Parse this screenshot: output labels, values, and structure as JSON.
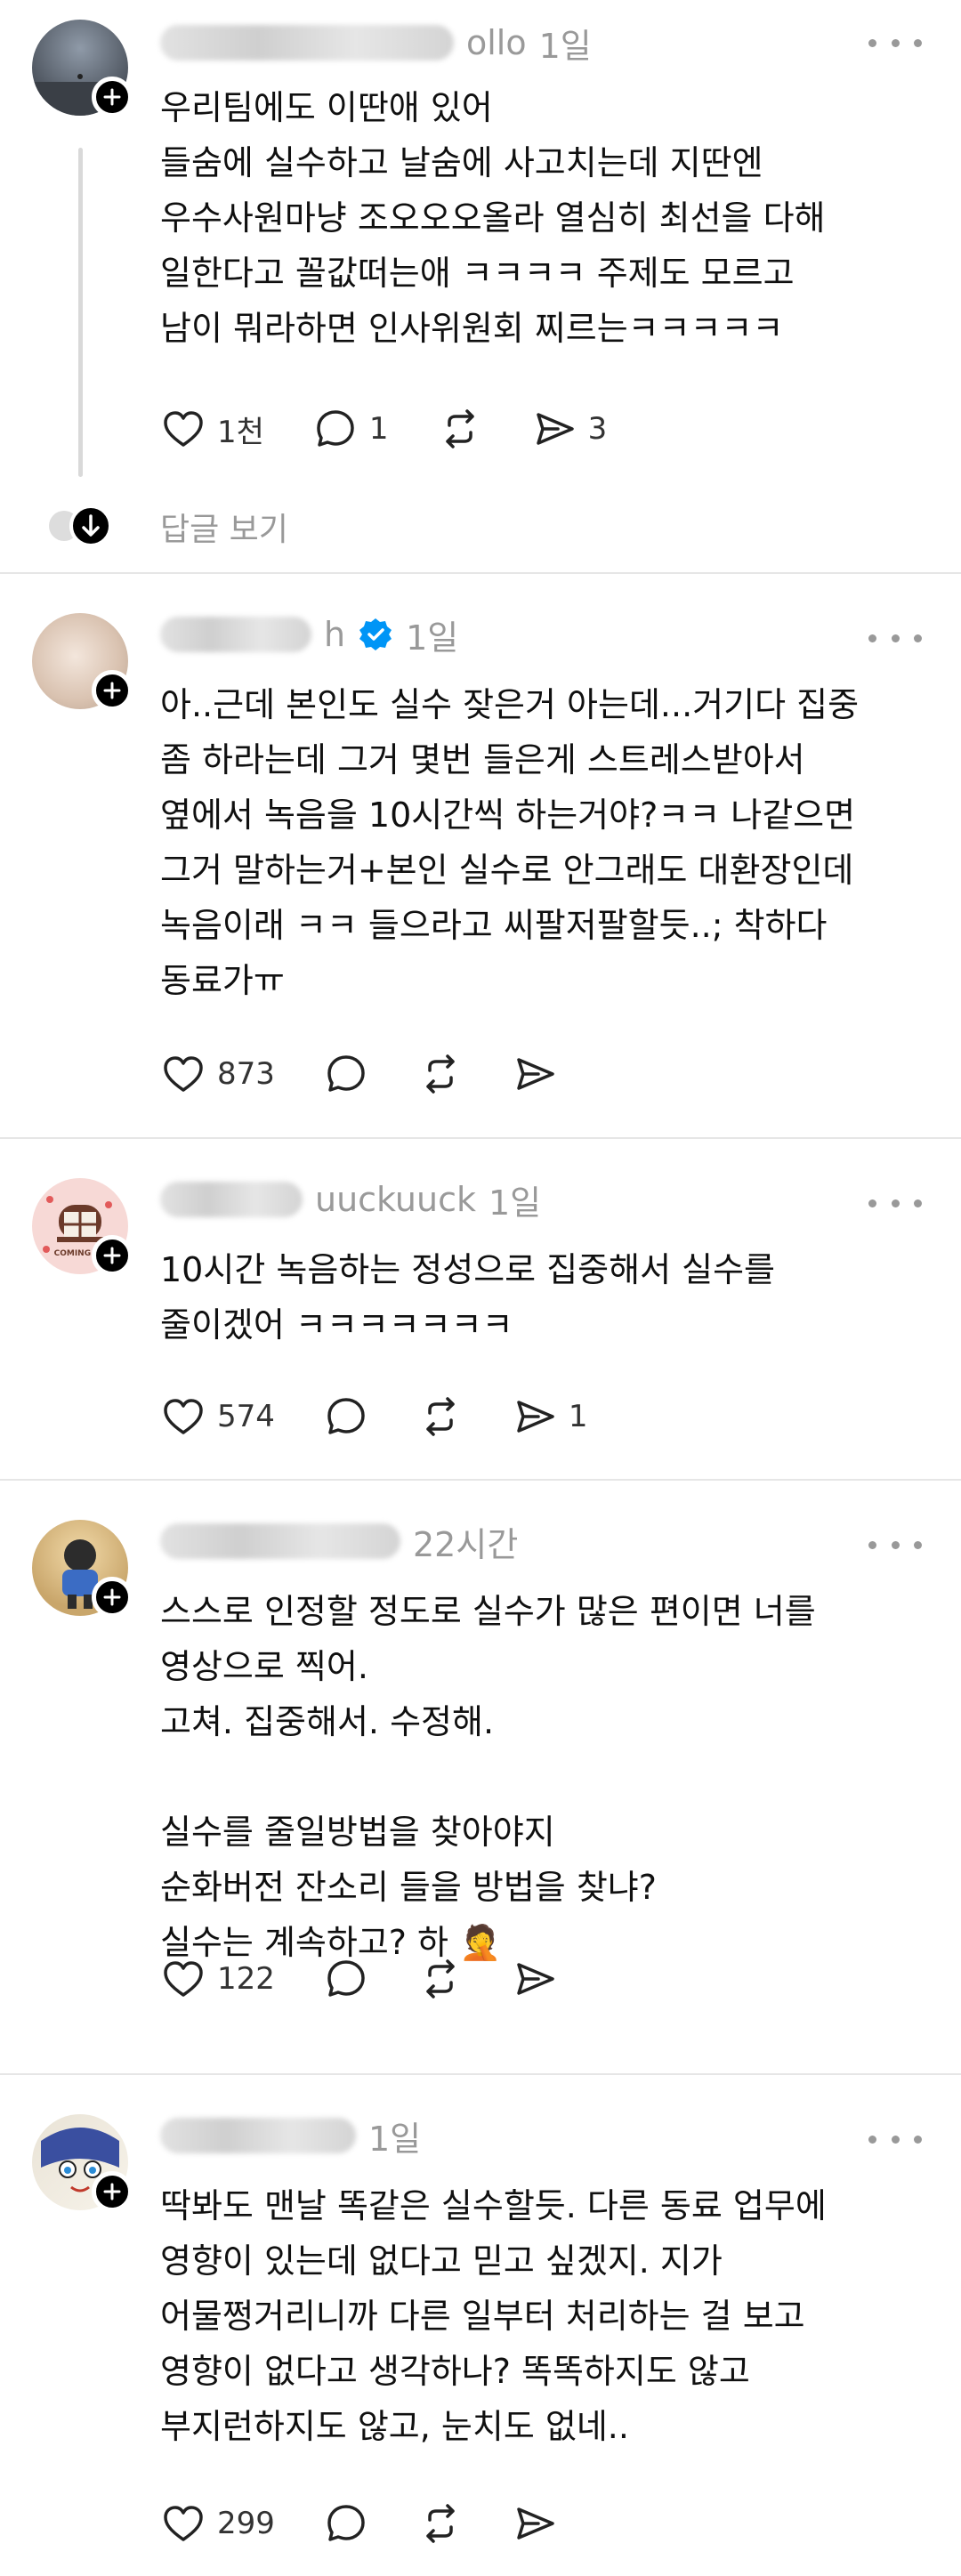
{
  "posts": [
    {
      "age": "1일",
      "username_tail": "ollo",
      "text": "우리팀에도 이딴애 있어\n들숨에 실수하고 날숨에 사고치는데 지딴엔\n우수사원마냥 조오오오올라 열심히 최선을 다해\n일한다고 꼴값떠는애 ㅋㅋㅋㅋ 주제도 모르고\n남이 뭐라하면 인사위원회 찌르는ㅋㅋㅋㅋㅋ",
      "likes": "1천",
      "comments": "1",
      "reposts": "",
      "shares": "3",
      "view_replies": "답글 보기"
    },
    {
      "age": "1일",
      "username_tail": "h",
      "text": "아..근데 본인도 실수 잦은거 아는데...거기다 집중\n좀 하라는데 그거 몇번 들은게 스트레스받아서\n옆에서 녹음을 10시간씩 하는거야?ㅋㅋ 나같으면\n그거 말하는거+본인 실수로 안그래도 대환장인데\n녹음이래 ㅋㅋ 들으라고 씨팔저팔할듯..; 착하다\n동료가ㅠ",
      "likes": "873",
      "comments": "",
      "reposts": "",
      "shares": ""
    },
    {
      "age": "1일",
      "username_tail": "uuckuuck",
      "avatar_label": "COMING SO",
      "text": "10시간 녹음하는 정성으로 집중해서 실수를\n줄이겠어 ㅋㅋㅋㅋㅋㅋㅋ",
      "likes": "574",
      "comments": "",
      "reposts": "",
      "shares": "1"
    },
    {
      "age": "22시간",
      "username_tail": "",
      "text": "스스로 인정할 정도로 실수가 많은 편이면 너를\n영상으로 찍어.\n고쳐. 집중해서. 수정해.\n\n실수를 줄일방법을 찾아야지\n순화버전 잔소리 들을 방법을 찾냐?\n실수는 계속하고? 하 🤦",
      "likes": "122",
      "comments": "",
      "reposts": "",
      "shares": ""
    },
    {
      "age": "1일",
      "username_tail": "",
      "text": "딱봐도 맨날 똑같은 실수할듯. 다른 동료 업무에\n영향이 있는데 없다고 믿고 싶겠지. 지가\n어물쩡거리니까 다른 일부터 처리하는 걸 보고\n영향이 없다고 생각하나? 똑똑하지도 않고\n부지런하지도 않고, 눈치도 없네..",
      "likes": "299",
      "comments": "",
      "reposts": "",
      "shares": ""
    }
  ],
  "icons": {
    "like": "heart-icon",
    "comment": "comment-icon",
    "repost": "repost-icon",
    "share": "share-icon",
    "more": "more-icon",
    "verified": "verified-badge-icon"
  },
  "colors": {
    "verified": "#0095f6",
    "muted": "#999999",
    "text": "#101010"
  }
}
